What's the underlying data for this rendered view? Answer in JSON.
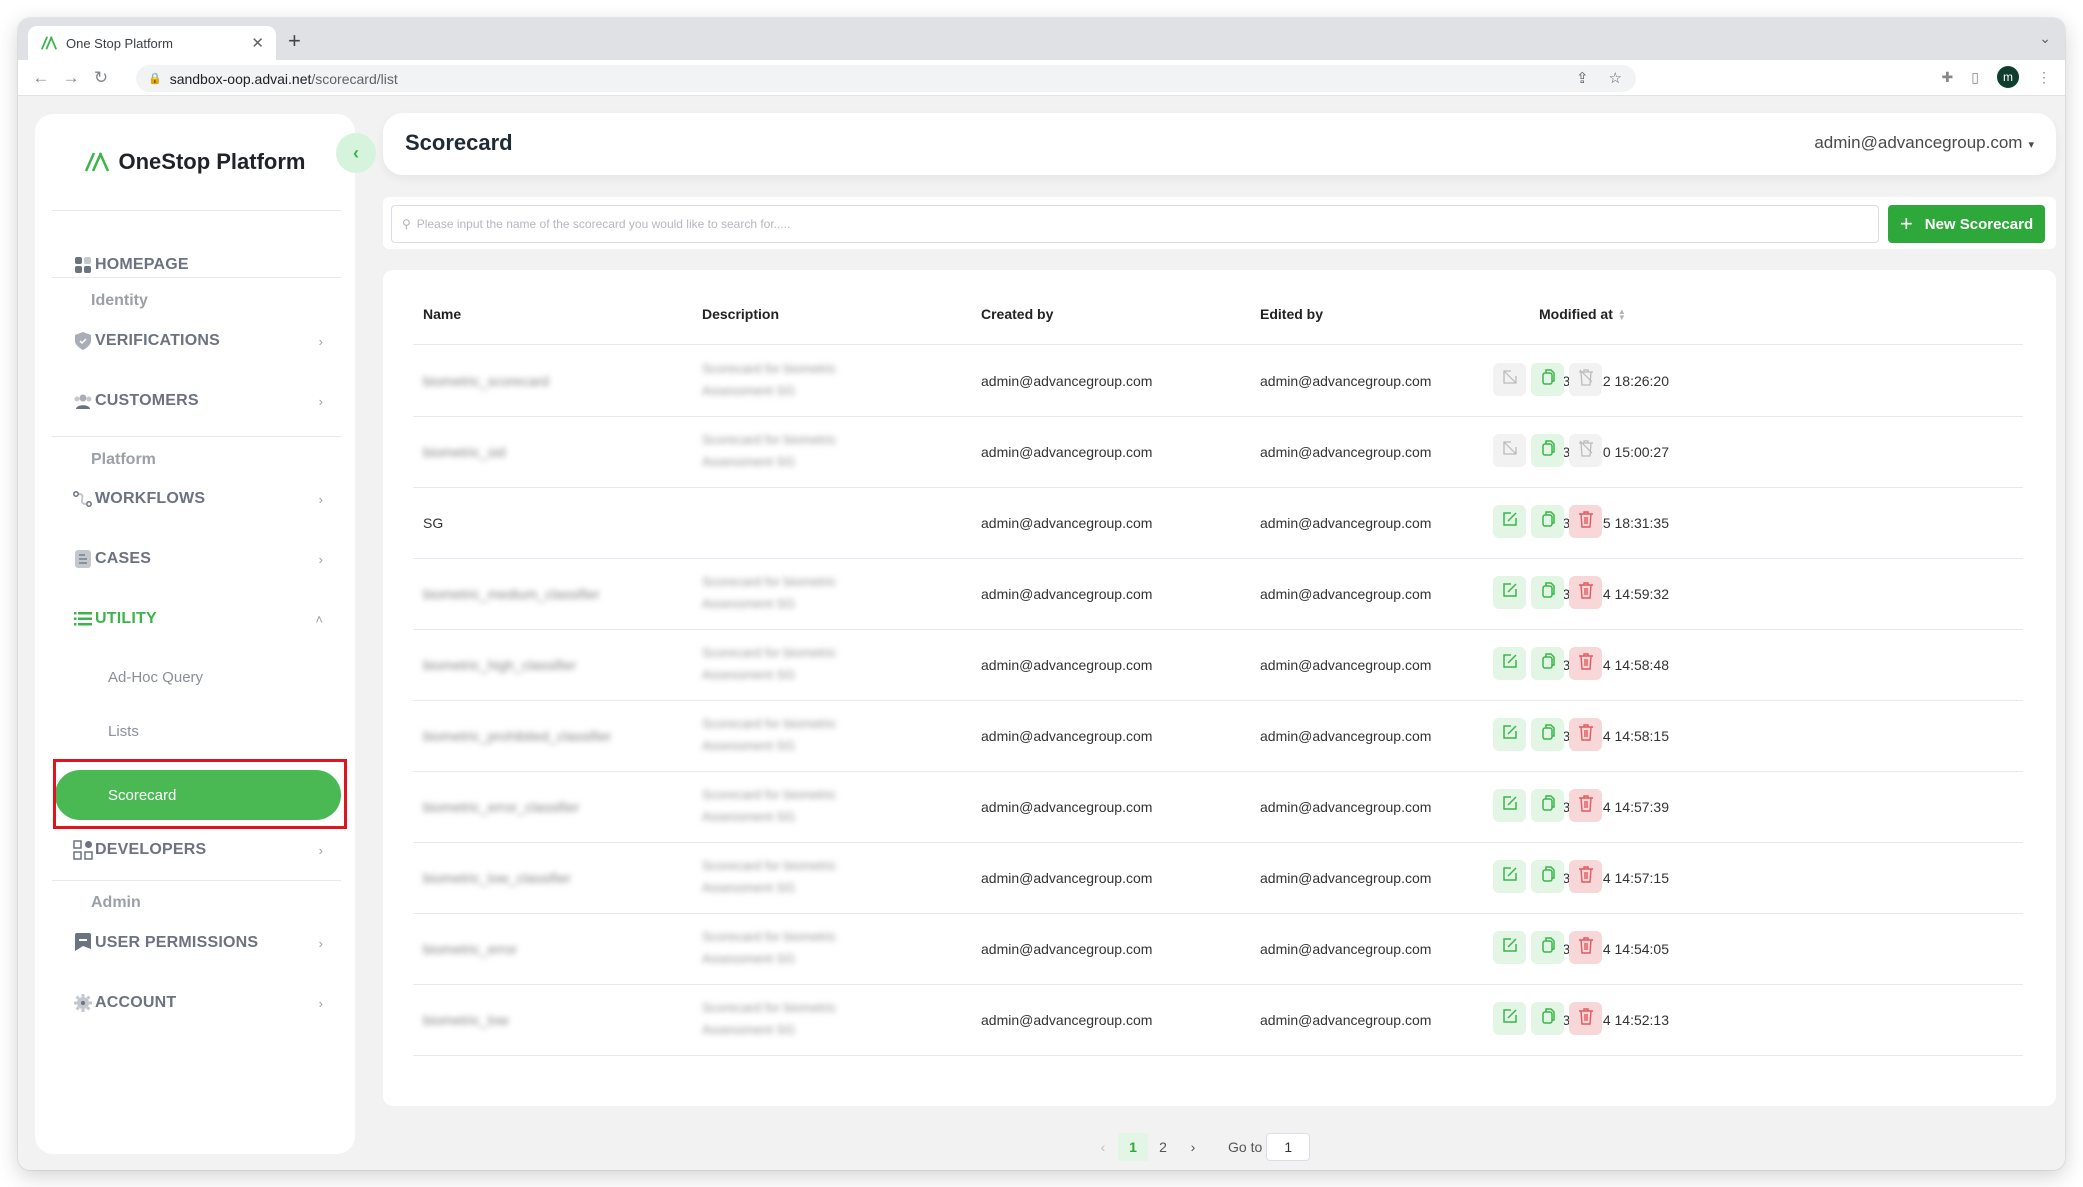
{
  "browser": {
    "tab_title": "One Stop Platform",
    "url_host": "sandbox-oop.advai.net",
    "url_path": "/scorecard/list",
    "profile_initial": "m"
  },
  "sidebar": {
    "brand": "OneStop Platform",
    "homepage": "HOMEPAGE",
    "sections": {
      "identity": "Identity",
      "platform": "Platform",
      "admin": "Admin"
    },
    "items": {
      "verifications": "VERIFICATIONS",
      "customers": "CUSTOMERS",
      "workflows": "WORKFLOWS",
      "cases": "CASES",
      "utility": "UTILITY",
      "developers": "DEVELOPERS",
      "user_permissions": "USER PERMISSIONS",
      "account": "ACCOUNT"
    },
    "utility_sub": {
      "adhoc": "Ad-Hoc Query",
      "lists": "Lists",
      "scorecard": "Scorecard"
    }
  },
  "header": {
    "title": "Scorecard",
    "user": "admin@advancegroup.com"
  },
  "search": {
    "placeholder": "Please input the name of the scorecard you would like to search for.....",
    "value": ""
  },
  "new_button": "New Scorecard",
  "table": {
    "columns": [
      "Name",
      "Description",
      "Created by",
      "Edited by",
      "Modified at"
    ],
    "rows": [
      {
        "name": "biometric_scorecard",
        "desc1": "Scorecard for biometric",
        "desc2": "Assessment SG",
        "name_blurred": true,
        "created_by": "admin@advancegroup.com",
        "edited_by": "admin@advancegroup.com",
        "modified": "2023-07-12 18:26:20",
        "locked": true
      },
      {
        "name": "biometric_sid",
        "desc1": "Scorecard for biometric",
        "desc2": "Assessment SG",
        "name_blurred": true,
        "created_by": "admin@advancegroup.com",
        "edited_by": "admin@advancegroup.com",
        "modified": "2023-07-10 15:00:27",
        "locked": true
      },
      {
        "name": "SG",
        "desc1": "",
        "desc2": "",
        "name_blurred": false,
        "created_by": "admin@advancegroup.com",
        "edited_by": "admin@advancegroup.com",
        "modified": "2023-06-15 18:31:35",
        "locked": false
      },
      {
        "name": "biometric_medium_classifier",
        "desc1": "Scorecard for biometric",
        "desc2": "Assessment SG",
        "name_blurred": true,
        "created_by": "admin@advancegroup.com",
        "edited_by": "admin@advancegroup.com",
        "modified": "2023-06-14 14:59:32",
        "locked": false
      },
      {
        "name": "biometric_high_classifier",
        "desc1": "Scorecard for biometric",
        "desc2": "Assessment SG",
        "name_blurred": true,
        "created_by": "admin@advancegroup.com",
        "edited_by": "admin@advancegroup.com",
        "modified": "2023-06-14 14:58:48",
        "locked": false
      },
      {
        "name": "biometric_prohibited_classifier",
        "desc1": "Scorecard for biometric",
        "desc2": "Assessment SG",
        "name_blurred": true,
        "created_by": "admin@advancegroup.com",
        "edited_by": "admin@advancegroup.com",
        "modified": "2023-06-14 14:58:15",
        "locked": false
      },
      {
        "name": "biometric_error_classifier",
        "desc1": "Scorecard for biometric",
        "desc2": "Assessment SG",
        "name_blurred": true,
        "created_by": "admin@advancegroup.com",
        "edited_by": "admin@advancegroup.com",
        "modified": "2023-06-14 14:57:39",
        "locked": false
      },
      {
        "name": "biometric_low_classifier",
        "desc1": "Scorecard for biometric",
        "desc2": "Assessment SG",
        "name_blurred": true,
        "created_by": "admin@advancegroup.com",
        "edited_by": "admin@advancegroup.com",
        "modified": "2023-06-14 14:57:15",
        "locked": false
      },
      {
        "name": "biometric_error",
        "desc1": "Scorecard for biometric",
        "desc2": "Assessment SG",
        "name_blurred": true,
        "created_by": "admin@advancegroup.com",
        "edited_by": "admin@advancegroup.com",
        "modified": "2023-06-14 14:54:05",
        "locked": false
      },
      {
        "name": "biometric_low",
        "desc1": "Scorecard for biometric",
        "desc2": "Assessment SG",
        "name_blurred": true,
        "created_by": "admin@advancegroup.com",
        "edited_by": "admin@advancegroup.com",
        "modified": "2023-06-14 14:52:13",
        "locked": false
      }
    ]
  },
  "pagination": {
    "prev": "‹",
    "pages": [
      "1",
      "2"
    ],
    "current": "1",
    "next": "›",
    "goto_label": "Go to",
    "goto_value": "1"
  },
  "colors": {
    "brand_green": "#3bb54a",
    "button_green": "#2ea83a",
    "delete_red": "#e05a5f",
    "highlight_red": "#e0141e"
  }
}
